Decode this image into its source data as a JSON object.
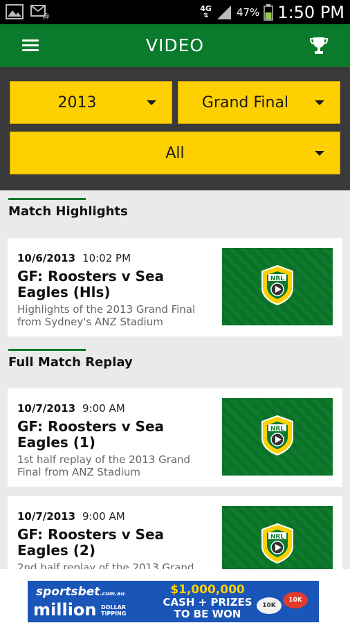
{
  "status": {
    "network": "4G",
    "battery": "47%",
    "time": "1:50 PM"
  },
  "appbar": {
    "title": "VIDEO",
    "menu_icon": "menu-icon",
    "trophy_icon": "trophy-icon"
  },
  "filters": {
    "year": "2013",
    "round": "Grand Final",
    "team": "All"
  },
  "sections": [
    {
      "title": "Match Highlights",
      "items": [
        {
          "date": "10/6/2013",
          "time": "10:02 PM",
          "title": "GF: Roosters v Sea Eagles (Hls)",
          "description": "Highlights of the 2013 Grand Final from Sydney's ANZ Stadium"
        }
      ]
    },
    {
      "title": "Full Match Replay",
      "items": [
        {
          "date": "10/7/2013",
          "time": "9:00 AM",
          "title": "GF: Roosters v Sea Eagles (1)",
          "description": "1st half replay of the 2013 Grand Final from ANZ Stadium"
        },
        {
          "date": "10/7/2013",
          "time": "9:00 AM",
          "title": "GF: Roosters v Sea Eagles (2)",
          "description": "2nd half replay of the 2013 Grand"
        }
      ]
    }
  ],
  "ad": {
    "brand": "sportsbet",
    "brand_suffix": ".com.au",
    "million": "million",
    "tipping": "DOLLAR TIPPING",
    "prize_amount": "$1,000,000",
    "prize_line": "CASH + PRIZES",
    "prize_cta": "TO BE WON",
    "ball_1": "10K",
    "ball_2": "10K"
  },
  "colors": {
    "appbar": "#0a7a2c",
    "dropdown": "#ffd000",
    "filter_bg": "#3a3a3a"
  }
}
